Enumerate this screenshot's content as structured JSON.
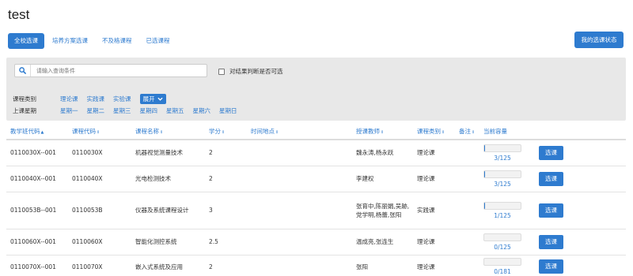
{
  "page": {
    "title": "test"
  },
  "tabs": [
    {
      "label": "全校选课",
      "active": true
    },
    {
      "label": "培养方案选课",
      "active": false
    },
    {
      "label": "不及格课程",
      "active": false
    },
    {
      "label": "已选课程",
      "active": false
    }
  ],
  "my_status_button": "我的选课状态",
  "filter": {
    "search_placeholder": "请输入查询条件",
    "result_checkbox_label": "对结果判断是否可选",
    "category_label": "课程类别",
    "categories": [
      "理论课",
      "实践课",
      "实验课"
    ],
    "expand_label": "展开",
    "weekday_label": "上课星期",
    "weekdays": [
      "星期一",
      "星期二",
      "星期三",
      "星期四",
      "星期五",
      "星期六",
      "星期日"
    ]
  },
  "table": {
    "headers": [
      "教学班代码",
      "课程代码",
      "课程名称",
      "学分",
      "时间地点",
      "授课教师",
      "课程类别",
      "备注",
      "当前容量"
    ],
    "select_label": "选课",
    "rows": [
      {
        "class_code": "0110030X--001",
        "course_code": "0110030X",
        "name": "机器视觉测量技术",
        "credit": "2",
        "time_place": "",
        "teacher": "魏永涛,杨永跃",
        "category": "理论课",
        "note": "",
        "capacity": "3/125",
        "fill": 0.024
      },
      {
        "class_code": "0110040X--001",
        "course_code": "0110040X",
        "name": "光电检测技术",
        "credit": "2",
        "time_place": "",
        "teacher": "李建权",
        "category": "理论课",
        "note": "",
        "capacity": "3/125",
        "fill": 0.024
      },
      {
        "class_code": "0110053B--001",
        "course_code": "0110053B",
        "name": "仪器及系统课程设计",
        "credit": "3",
        "time_place": "",
        "teacher": "张育中,陈丽娟,吴跡,党学明,杨蕾,张阳",
        "category": "实践课",
        "note": "",
        "capacity": "1/125",
        "fill": 0.008
      },
      {
        "class_code": "0110060X--001",
        "course_code": "0110060X",
        "name": "智能化测控系统",
        "credit": "2.5",
        "time_place": "",
        "teacher": "温成亮,张连生",
        "category": "理论课",
        "note": "",
        "capacity": "0/125",
        "fill": 0
      },
      {
        "class_code": "0110070X--001",
        "course_code": "0110070X",
        "name": "嵌入式系统及应用",
        "credit": "2",
        "time_place": "",
        "teacher": "张阳",
        "category": "理论课",
        "note": "",
        "capacity": "0/181",
        "fill": 0
      }
    ]
  },
  "colors": {
    "accent": "#2e7bcf",
    "panel": "#e8e8e8"
  }
}
